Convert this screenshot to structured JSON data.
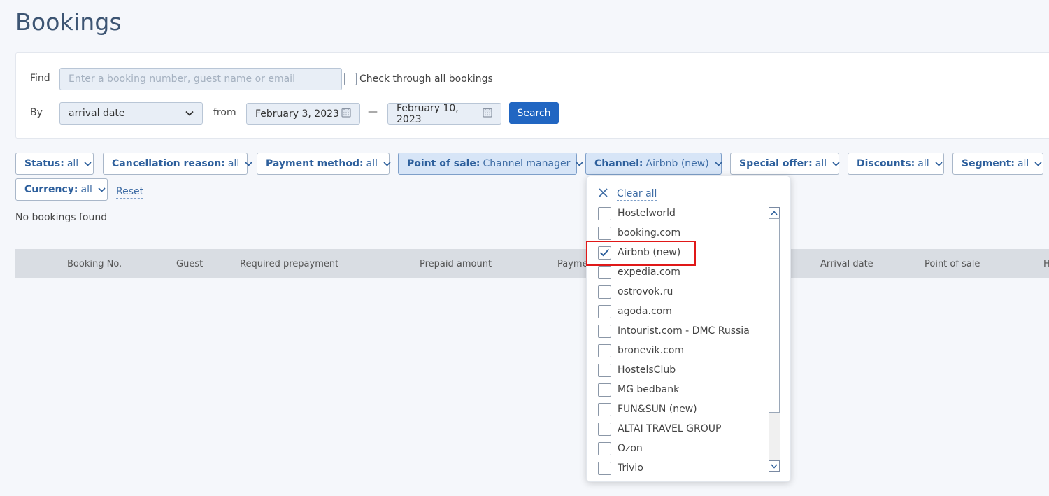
{
  "page": {
    "title": "Bookings"
  },
  "search": {
    "find_label": "Find",
    "find_placeholder": "Enter a booking number, guest name or email",
    "find_value": "",
    "check_all_label": "Check through all bookings",
    "by_label": "By",
    "by_value": "arrival date",
    "from_label": "from",
    "date_from": "February 3, 2023",
    "dash": "—",
    "date_to": "February 10, 2023",
    "search_button": "Search"
  },
  "filters": [
    {
      "key": "Status:",
      "value": "all"
    },
    {
      "key": "Cancellation reason:",
      "value": "all"
    },
    {
      "key": "Payment method:",
      "value": "all"
    },
    {
      "key": "Point of sale:",
      "value": "Channel manager"
    },
    {
      "key": "Channel:",
      "value": "Airbnb (new)"
    },
    {
      "key": "Special offer:",
      "value": "all"
    },
    {
      "key": "Discounts:",
      "value": "all"
    },
    {
      "key": "Segment:",
      "value": "all"
    },
    {
      "key": "Currency:",
      "value": "all"
    }
  ],
  "reset_label": "Reset",
  "results": {
    "empty_text": "No bookings found"
  },
  "table": {
    "columns": [
      "Booking No.",
      "Guest",
      "Required prepayment",
      "Prepaid amount",
      "Payme",
      "Arrival date",
      "Point of sale",
      "H"
    ]
  },
  "channel_dropdown": {
    "clear_all": "Clear all",
    "options": [
      {
        "label": "Hostelworld",
        "checked": false
      },
      {
        "label": "booking.com",
        "checked": false
      },
      {
        "label": "Airbnb (new)",
        "checked": true
      },
      {
        "label": "expedia.com",
        "checked": false
      },
      {
        "label": "ostrovok.ru",
        "checked": false
      },
      {
        "label": "agoda.com",
        "checked": false
      },
      {
        "label": "Intourist.com - DMC Russia",
        "checked": false
      },
      {
        "label": "bronevik.com",
        "checked": false
      },
      {
        "label": "HostelsClub",
        "checked": false
      },
      {
        "label": "MG bedbank",
        "checked": false
      },
      {
        "label": "FUN&SUN (new)",
        "checked": false
      },
      {
        "label": "ALTAI TRAVEL GROUP",
        "checked": false
      },
      {
        "label": "Ozon",
        "checked": false
      },
      {
        "label": "Trivio",
        "checked": false
      }
    ]
  },
  "icons": {
    "calendar": "calendar-icon",
    "chevron": "chevron-down-icon",
    "close": "close-icon",
    "check": "checkmark-icon"
  },
  "colors": {
    "accent": "#2166c2",
    "highlight": "#e01818",
    "title": "#3d5573"
  }
}
